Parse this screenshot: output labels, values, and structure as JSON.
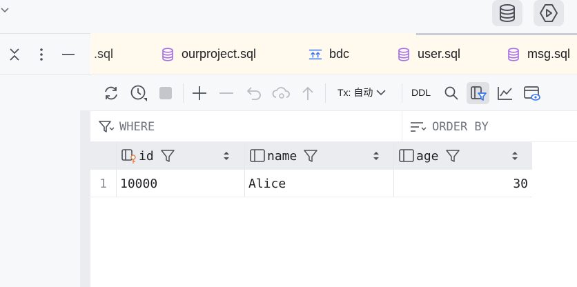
{
  "tabs": [
    {
      "label": ".sql",
      "icon": "database-icon",
      "partial": true
    },
    {
      "label": "ourproject.sql",
      "icon": "database-icon"
    },
    {
      "label": "bdc",
      "icon": "table-sync-icon"
    },
    {
      "label": "user.sql",
      "icon": "database-icon"
    },
    {
      "label": "msg.sql",
      "icon": "database-icon"
    }
  ],
  "toolbar": {
    "tx_label": "Tx: 自动",
    "ddl_label": "DDL"
  },
  "filter": {
    "where_placeholder": "WHERE",
    "order_placeholder": "ORDER BY"
  },
  "grid": {
    "columns": [
      {
        "name": "id",
        "icon": "primary-key-column-icon"
      },
      {
        "name": "name",
        "icon": "column-icon"
      },
      {
        "name": "age",
        "icon": "column-icon"
      }
    ],
    "rows": [
      {
        "row_number": "1",
        "id": "10000",
        "name": "Alice",
        "age": "30"
      }
    ]
  },
  "colors": {
    "tab_bar_bg": "#fff9ee",
    "toolbar_bg": "#f7f8fa",
    "icon_purple": "#a571e6",
    "icon_blue": "#3574f0",
    "key_orange": "#e08855"
  }
}
